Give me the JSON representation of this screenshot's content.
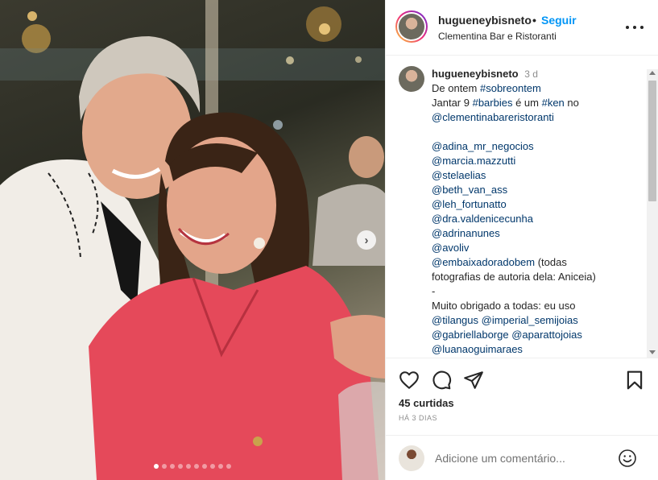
{
  "post": {
    "photo_alt": "Foto do post",
    "carousel": {
      "total": 10,
      "active": 0
    }
  },
  "header": {
    "username": "hugueneybisneto",
    "separator": "•",
    "follow_label": "Seguir",
    "location": "Clementina Bar e Ristoranti"
  },
  "caption": {
    "username": "hugueneybisneto",
    "time": "3 d",
    "lines": [
      [
        {
          "t": "De ontem "
        },
        {
          "t": "#sobreontem",
          "link": true
        }
      ],
      [
        {
          "t": "Jantar 9 "
        },
        {
          "t": "#barbies",
          "link": true
        },
        {
          "t": " é um "
        },
        {
          "t": "#ken",
          "link": true
        },
        {
          "t": " no"
        }
      ],
      [
        {
          "t": "@clementinabareristoranti",
          "link": true
        }
      ],
      [],
      [
        {
          "t": "@adina_mr_negocios",
          "link": true
        }
      ],
      [
        {
          "t": "@marcia.mazzutti",
          "link": true
        }
      ],
      [
        {
          "t": "@stelaelias",
          "link": true
        }
      ],
      [
        {
          "t": "@beth_van_ass",
          "link": true
        }
      ],
      [
        {
          "t": "@leh_fortunatto",
          "link": true
        }
      ],
      [
        {
          "t": "@dra.valdenicecunha",
          "link": true
        }
      ],
      [
        {
          "t": "@adrinanunes",
          "link": true
        }
      ],
      [
        {
          "t": "@avoliv",
          "link": true
        }
      ],
      [
        {
          "t": "@embaixadoradobem",
          "link": true
        },
        {
          "t": " (todas"
        }
      ],
      [
        {
          "t": "fotografias de autoria dela: Aniceia)"
        }
      ],
      [
        {
          "t": "-"
        }
      ],
      [
        {
          "t": "Muito obrigado a todas: eu uso"
        }
      ],
      [
        {
          "t": "@tilangus",
          "link": true
        },
        {
          "t": " "
        },
        {
          "t": "@imperial_semijoias",
          "link": true
        }
      ],
      [
        {
          "t": "@gabriellaborge",
          "link": true
        },
        {
          "t": " "
        },
        {
          "t": "@aparattojoias",
          "link": true
        }
      ],
      [
        {
          "t": "@luanaoguimaraes",
          "link": true
        }
      ]
    ]
  },
  "actions": {
    "likes": "45 curtidas",
    "date": "HÁ 3 DIAS"
  },
  "add_comment": {
    "placeholder": "Adicione um comentário..."
  },
  "colors": {
    "follow": "#0095f6",
    "link": "#00376b",
    "muted": "#8e8e8e",
    "text": "#262626"
  },
  "icons": [
    "heart-icon",
    "comment-icon",
    "share-icon",
    "bookmark-icon",
    "more-icon",
    "emoji-icon",
    "chevron-right-icon"
  ]
}
